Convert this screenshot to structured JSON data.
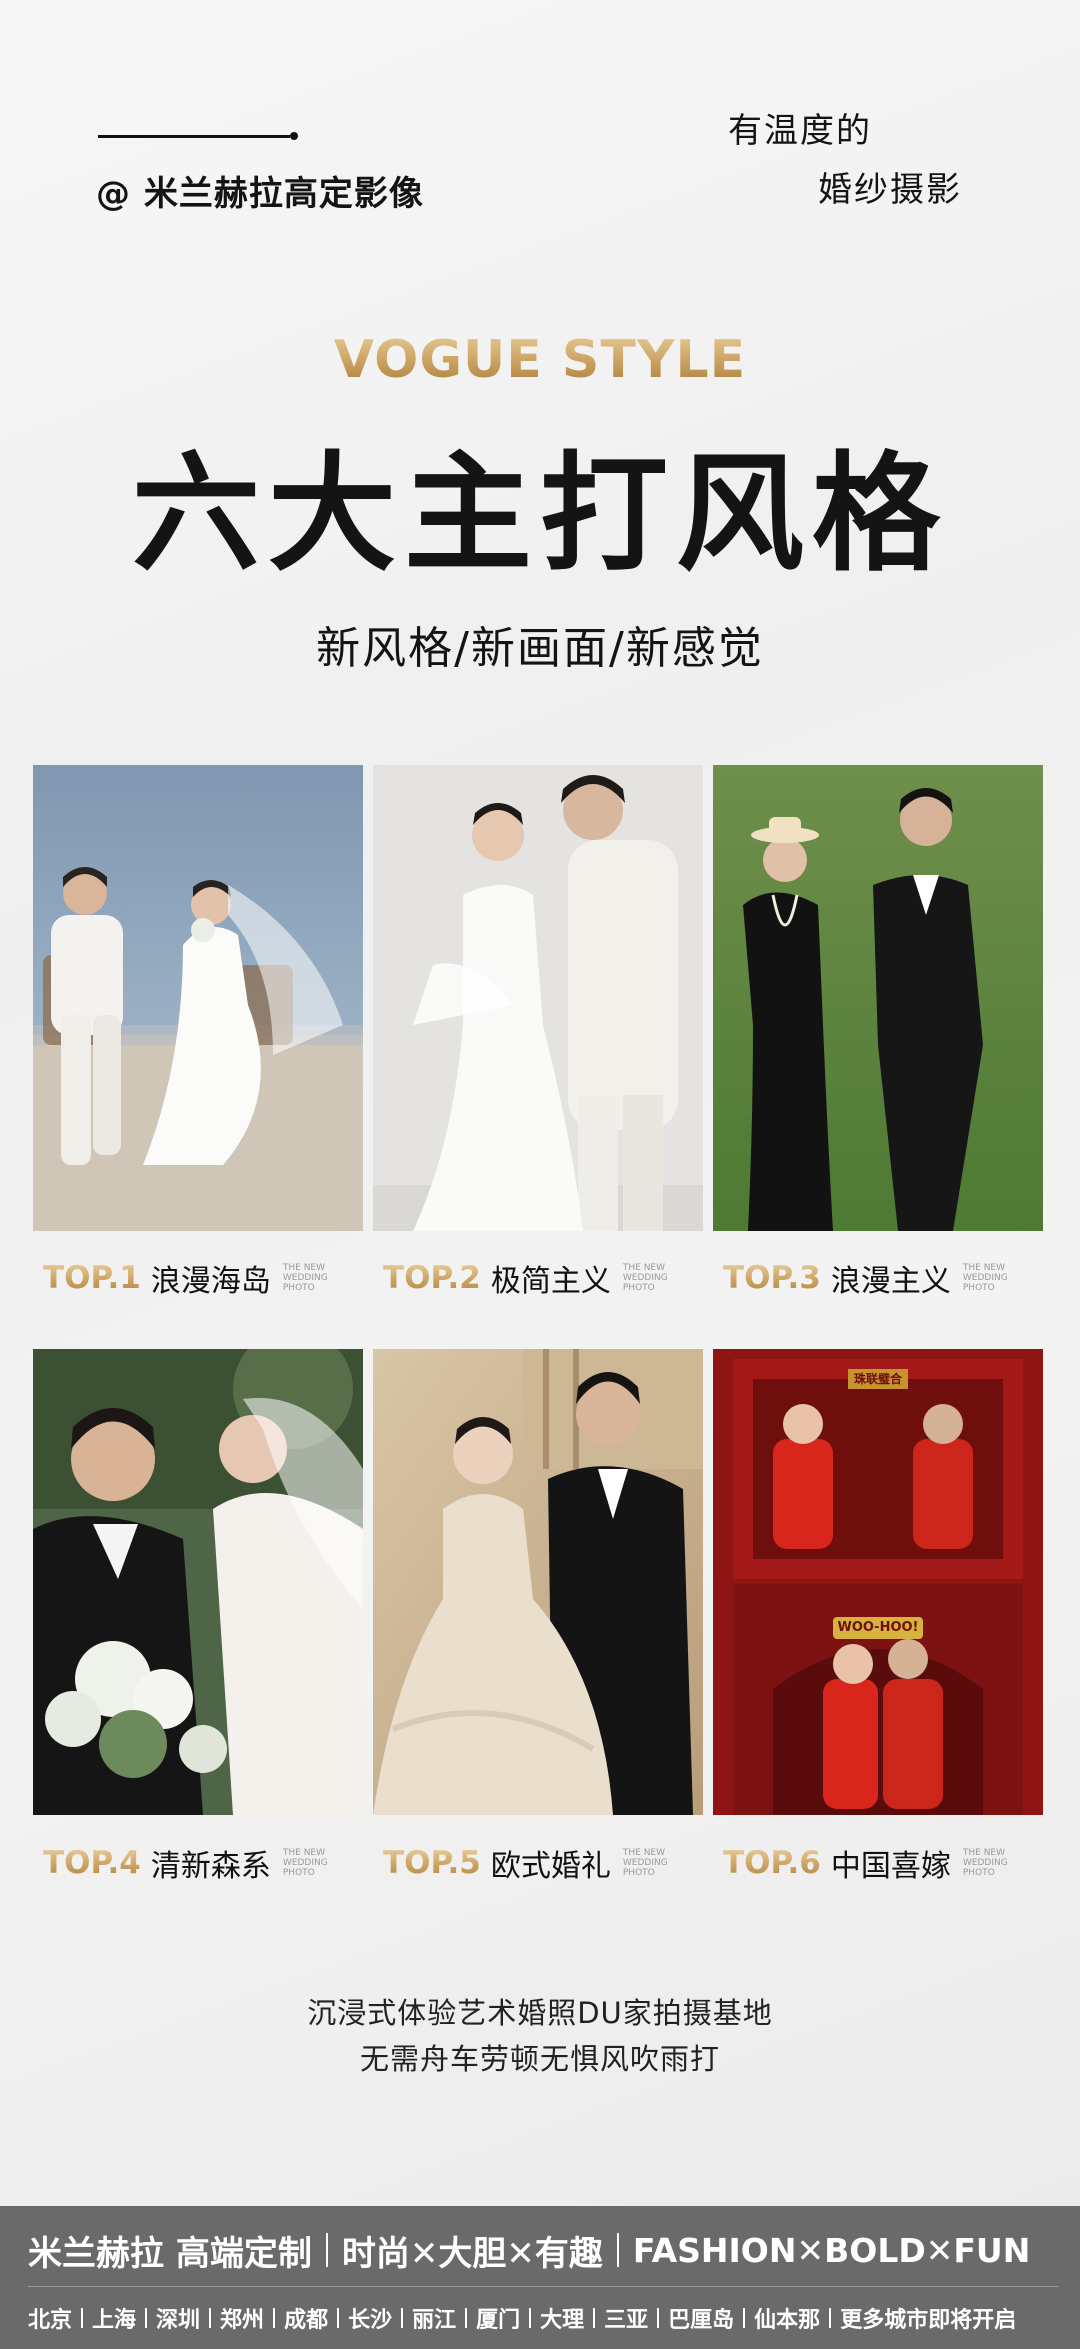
{
  "header": {
    "brand": "@ 米兰赫拉高定影像",
    "tagline_line1": "有温度的",
    "tagline_line2": "婚纱摄影"
  },
  "hero": {
    "english_title": "VOGUE STYLE",
    "title": "六大主打风格",
    "subtitle": "新风格/新画面/新感觉"
  },
  "styles": [
    {
      "rank": "TOP.1",
      "name": "浪漫海岛",
      "tiny": "THE NEW WEDDING PHOTO"
    },
    {
      "rank": "TOP.2",
      "name": "极简主义",
      "tiny": "THE NEW WEDDING PHOTO"
    },
    {
      "rank": "TOP.3",
      "name": "浪漫主义",
      "tiny": "THE NEW WEDDING PHOTO"
    },
    {
      "rank": "TOP.4",
      "name": "清新森系",
      "tiny": "THE NEW WEDDING PHOTO"
    },
    {
      "rank": "TOP.5",
      "name": "欧式婚礼",
      "tiny": "THE NEW WEDDING PHOTO"
    },
    {
      "rank": "TOP.6",
      "name": "中国喜嫁",
      "tiny": "THE NEW WEDDING PHOTO"
    }
  ],
  "photo6_signs": {
    "top": "珠联璧合",
    "bottom": "WOO-HOO!"
  },
  "closing": {
    "line1": "沉浸式体验艺术婚照DU家拍摄基地",
    "line2": "无需舟车劳顿无惧风吹雨打"
  },
  "footer": {
    "slogan1": "米兰赫拉 高端定制",
    "slogan2": "时尚✕大胆✕有趣",
    "slogan3": "FASHION✕BOLD✕FUN",
    "cities": [
      "北京",
      "上海",
      "深圳",
      "郑州",
      "成都",
      "长沙",
      "丽江",
      "厦门",
      "大理",
      "三亚",
      "巴厘岛",
      "仙本那",
      "更多城市即将开启"
    ]
  },
  "colors": {
    "gold": "#c9a05e",
    "footer_bg": "#6a6a6a",
    "text": "#141414"
  }
}
